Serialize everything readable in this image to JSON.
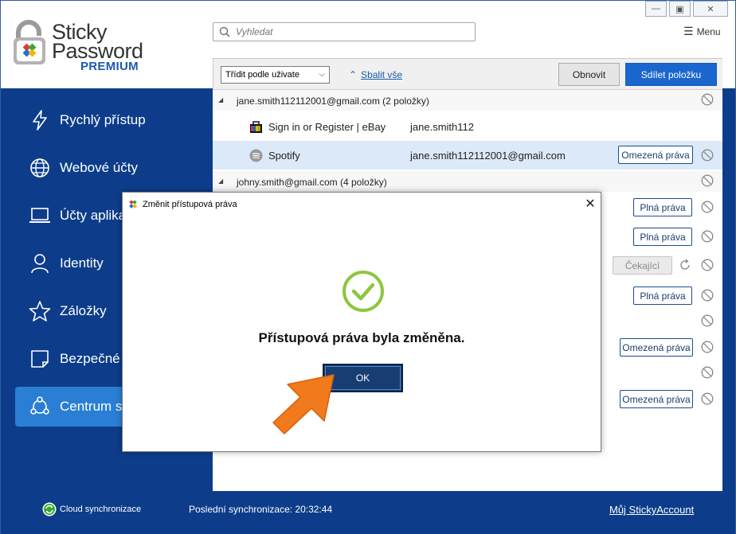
{
  "app": {
    "logo_line1": "Sticky",
    "logo_line2": "Password",
    "logo_line3": "PREMIUM",
    "menu_label": "Menu"
  },
  "search": {
    "placeholder": "Vyhledat"
  },
  "sidebar": {
    "items": [
      {
        "label": "Rychlý přístup",
        "icon": "lightning-icon"
      },
      {
        "label": "Webové účty",
        "icon": "globe-icon"
      },
      {
        "label": "Účty aplikací",
        "icon": "laptop-icon"
      },
      {
        "label": "Identity",
        "icon": "person-icon"
      },
      {
        "label": "Záložky",
        "icon": "star-icon"
      },
      {
        "label": "Bezpečné",
        "icon": "note-icon"
      },
      {
        "label": "Centrum s",
        "icon": "share-icon",
        "active": true
      }
    ]
  },
  "toolbar": {
    "sort_label": "Třídit podle uživate",
    "collapse_label": "Sbalit vše",
    "refresh_label": "Obnovit",
    "share_label": "Sdílet položku"
  },
  "list": {
    "group1": "jane.smith112112001@gmail.com (2 položky)",
    "item1_name": "Sign in or Register | eBay",
    "item1_user": "jane.smith112",
    "item2_name": "Spotify",
    "item2_user": "jane.smith112112001@gmail.com",
    "item2_rights": "Omezená práva",
    "group2": "johny.smith@gmail.com (4 položky)",
    "rights": [
      "Plná práva",
      "Plná práva",
      "Čekající",
      "Plná práva",
      "Omezená práva",
      "Omezená práva"
    ]
  },
  "dialog": {
    "title": "Změnit přístupová práva",
    "message": "Přístupová práva byla změněna.",
    "ok_label": "OK"
  },
  "footer": {
    "cloud_label": "Cloud synchronizace",
    "last_sync": "Poslední synchronizace: 20:32:44",
    "account_label": "Můj StickyAccount"
  },
  "colors": {
    "sidebar_bg": "#0d3d8a",
    "active_nav": "#2a7fd4",
    "primary_button": "#1a66cf",
    "check_green": "#8dc63f",
    "arrow_orange": "#f07a1c"
  }
}
